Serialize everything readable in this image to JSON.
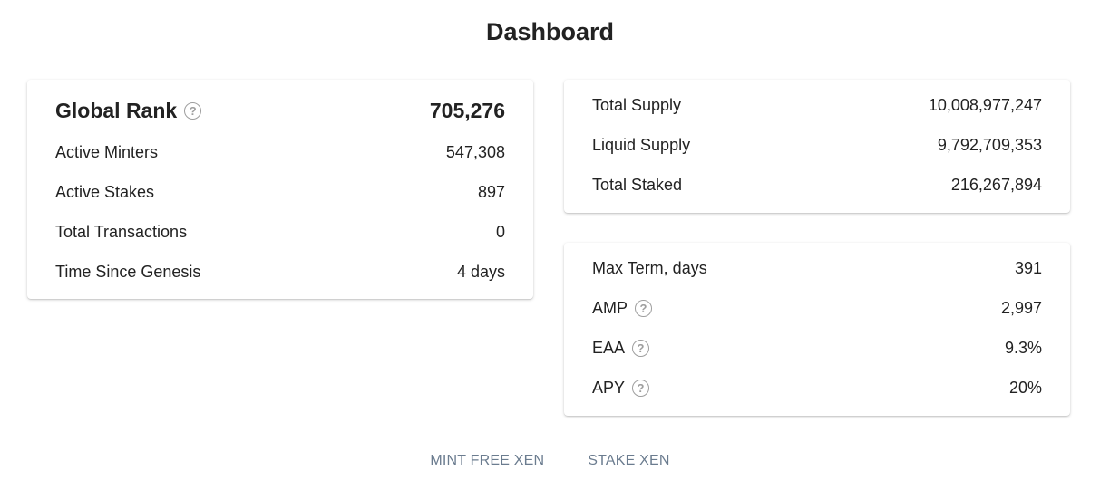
{
  "header": {
    "title": "Dashboard"
  },
  "global_card": {
    "rank": {
      "label": "Global Rank",
      "value": "705,276",
      "help_icon": "question-circle-icon"
    },
    "rows": [
      {
        "label": "Active Minters",
        "value": "547,308"
      },
      {
        "label": "Active Stakes",
        "value": "897"
      },
      {
        "label": "Total Transactions",
        "value": "0"
      },
      {
        "label": "Time Since Genesis",
        "value": "4 days"
      }
    ]
  },
  "supply_card": {
    "rows": [
      {
        "label": "Total Supply",
        "value": "10,008,977,247"
      },
      {
        "label": "Liquid Supply",
        "value": "9,792,709,353"
      },
      {
        "label": "Total Staked",
        "value": "216,267,894"
      }
    ]
  },
  "stats_card": {
    "rows": [
      {
        "label": "Max Term, days",
        "value": "391"
      },
      {
        "label": "AMP",
        "value": "2,997",
        "help_icon": "question-circle-icon"
      },
      {
        "label": "EAA",
        "value": "9.3%",
        "help_icon": "question-circle-icon"
      },
      {
        "label": "APY",
        "value": "20%",
        "help_icon": "question-circle-icon"
      }
    ]
  },
  "actions": {
    "mint_label": "MINT FREE XEN",
    "stake_label": "STAKE XEN"
  },
  "colors": {
    "text": "#222222",
    "icon": "#9e9e9e",
    "action": "#6b7c8f"
  }
}
